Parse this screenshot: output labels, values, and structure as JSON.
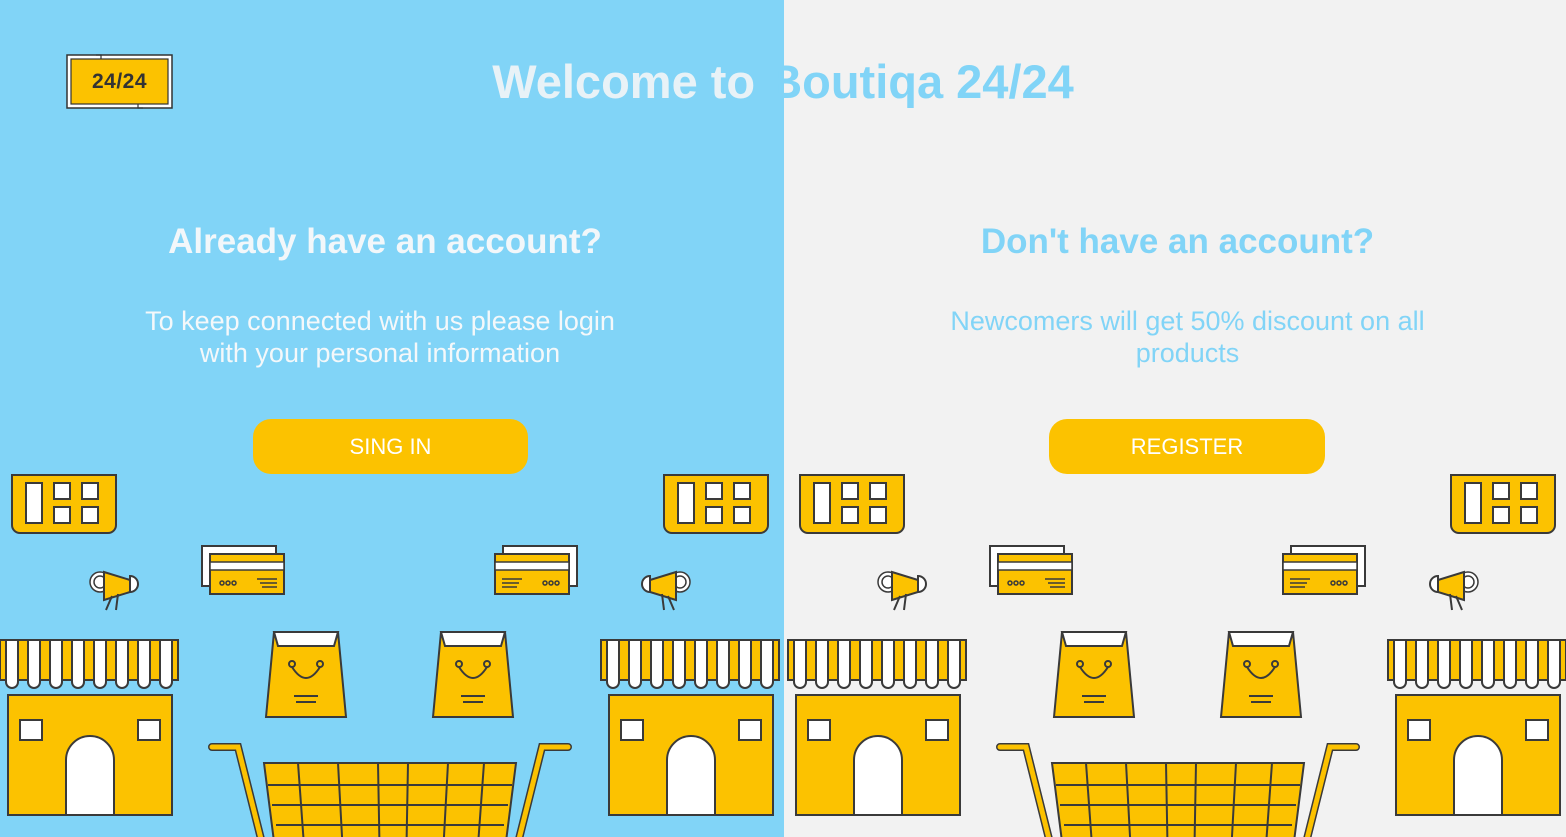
{
  "header": {
    "logo_text": "24/24",
    "welcome_prefix": "Welcome to ",
    "welcome_brand": "Boutiqa 24/24"
  },
  "signin": {
    "heading": "Already have an account?",
    "text": "To keep connected with us please login with your personal information",
    "button_label": "SING IN"
  },
  "register": {
    "heading": "Don't have an account?",
    "text": "Newcomers will get 50% discount on all products",
    "button_label": "REGISTER"
  },
  "colors": {
    "left_bg": "#81d4f7",
    "right_bg": "#f2f2f2",
    "accent": "#fcc200",
    "outline": "#3a3a3a"
  }
}
